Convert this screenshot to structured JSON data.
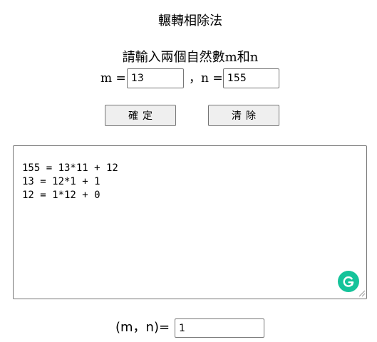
{
  "page": {
    "title": "輾轉相除法",
    "prompt": "請輸入兩個自然數m和n"
  },
  "inputs": {
    "m_label": "m =",
    "m_value": "13",
    "n_label": "，n =",
    "n_value": "155"
  },
  "buttons": {
    "confirm_label": "確定",
    "clear_label": "清除"
  },
  "output": {
    "text": "155 = 13*11 + 12\n13 = 12*1 + 1\n12 = 1*12 + 0"
  },
  "result": {
    "label": "(m，n)=",
    "value": "1"
  },
  "icons": {
    "grammarly": "grammarly-icon",
    "resize": "resize-grip-icon"
  },
  "colors": {
    "grammarly_green": "#15c39a",
    "button_bg": "#efefef",
    "border": "#767676"
  }
}
